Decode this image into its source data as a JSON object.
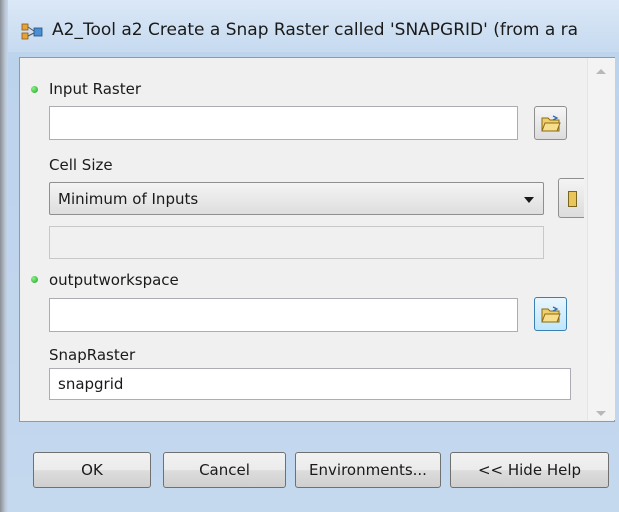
{
  "window": {
    "title": "A2_Tool a2 Create a Snap Raster called 'SNAPGRID' (from a ra"
  },
  "form": {
    "input_raster": {
      "label": "Input Raster",
      "value": "",
      "required": true
    },
    "cell_size": {
      "label": "Cell Size",
      "selected": "Minimum of Inputs",
      "secondary_value": ""
    },
    "outputworkspace": {
      "label": "outputworkspace",
      "value": "",
      "required": true
    },
    "snapraster": {
      "label": "SnapRaster",
      "value": "snapgrid"
    }
  },
  "buttons": {
    "ok": "OK",
    "cancel": "Cancel",
    "environments": "Environments...",
    "hide_help": "<< Hide Help"
  },
  "icons": {
    "app": "model-tool-icon",
    "browse": "open-folder-icon",
    "required": "green-dot-icon"
  },
  "colors": {
    "frame": "#c4d8ee",
    "required_dot": "#18a818",
    "active_button": "#3c7fb1"
  }
}
